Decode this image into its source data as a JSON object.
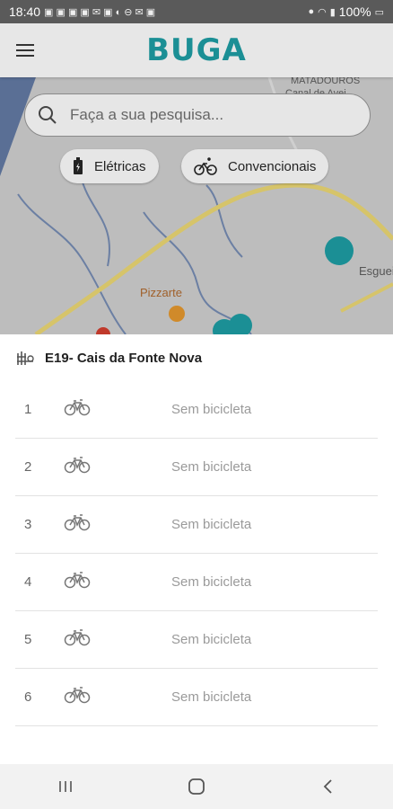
{
  "status_bar": {
    "time": "18:40",
    "battery": "100%"
  },
  "app": {
    "title": "BUGA"
  },
  "search": {
    "placeholder": "Faça a sua pesquisa..."
  },
  "filters": [
    {
      "label": "Elétricas",
      "icon": "battery-icon"
    },
    {
      "label": "Convencionais",
      "icon": "bicycle-icon"
    }
  ],
  "map_labels": {
    "place1": "MATADOUROS",
    "place2": "Esgueira",
    "place3": "Pizzarte",
    "place4": "Canal de Avei"
  },
  "station": {
    "name": "E19- Cais da Fonte Nova"
  },
  "slots": [
    {
      "number": "1",
      "status": "Sem bicicleta"
    },
    {
      "number": "2",
      "status": "Sem bicicleta"
    },
    {
      "number": "3",
      "status": "Sem bicicleta"
    },
    {
      "number": "4",
      "status": "Sem bicicleta"
    },
    {
      "number": "5",
      "status": "Sem bicicleta"
    },
    {
      "number": "6",
      "status": "Sem bicicleta"
    }
  ],
  "colors": {
    "brand": "#1b8f95",
    "map_bg": "#bdbdbd",
    "road": "#d6c46a"
  }
}
